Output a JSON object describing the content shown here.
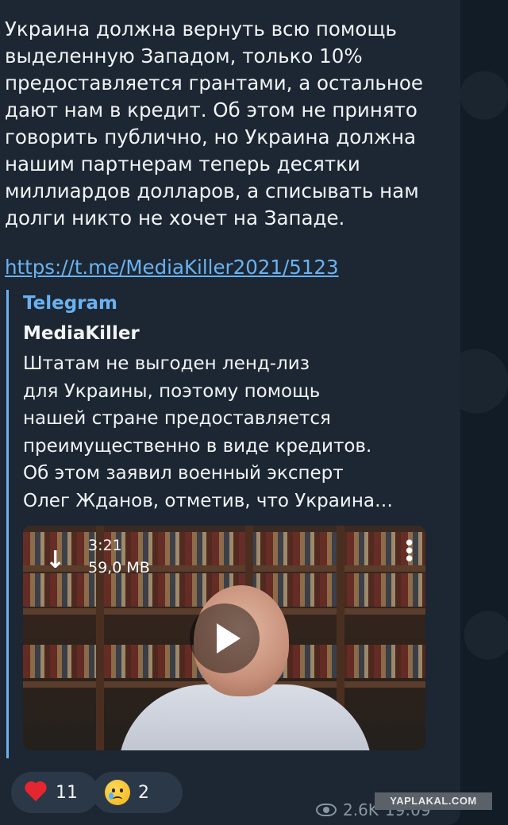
{
  "message": {
    "text": "Украина должна вернуть всю помощь\nвыделенную Западом, только 10%\nпредоставляется грантами, а остальное\nдают нам в кредит. Об этом не принято\nговорить публично, но Украина должна\nнашим партнерам теперь десятки\nмиллиардов долларов, а списывать нам\nдолги никто не хочет на Западе.",
    "link": "https://t.me/MediaKiller2021/5123"
  },
  "preview": {
    "site_name": "Telegram",
    "title": "MediaKiller",
    "description": "Штатам не выгоден ленд-лиз\nдля Украины, поэтому помощь\nнашей стране предоставляется\nпреимущественно в виде кредитов.\nОб этом заявил военный эксперт\nОлег Жданов, отметив, что Украина…",
    "video": {
      "duration": "3:21",
      "size": "59,0 MB",
      "download_icon": "download-arrow-icon",
      "menu_icon": "more-vertical-icon",
      "play_icon": "play-icon"
    }
  },
  "reactions": [
    {
      "icon": "heart-icon",
      "count": "11"
    },
    {
      "icon": "crying-face-icon",
      "count": "2"
    }
  ],
  "footer": {
    "views": "2.6K",
    "time": "19:09"
  },
  "watermark": "YAPLAKAL.COM",
  "colors": {
    "bubble": "#1c2733",
    "link": "#6ab2f2",
    "text": "#f1f3f5",
    "meta": "#8a96a3"
  }
}
